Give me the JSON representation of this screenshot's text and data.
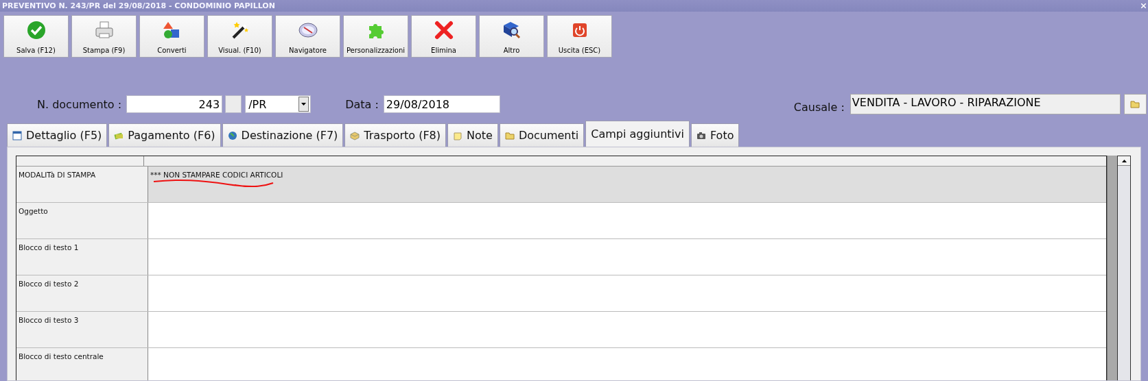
{
  "window": {
    "title": "PREVENTIVO N. 243/PR del 29/08/2018 - CONDOMINIO PAPILLON"
  },
  "toolbar": [
    {
      "label": "Salva (F12)",
      "kind": "check"
    },
    {
      "label": "Stampa (F9)",
      "kind": "printer"
    },
    {
      "label": "Converti",
      "kind": "convert"
    },
    {
      "label": "Visual. (F10)",
      "kind": "wand"
    },
    {
      "label": "Navigatore",
      "kind": "compass"
    },
    {
      "label": "Personalizzazioni",
      "kind": "puzzle"
    },
    {
      "label": "Elimina",
      "kind": "cross"
    },
    {
      "label": "Altro",
      "kind": "book"
    },
    {
      "label": "Uscita (ESC)",
      "kind": "power"
    }
  ],
  "form": {
    "document_label": "N. documento :",
    "document_number": "243",
    "series": "/PR",
    "date_label": "Data :",
    "date": "29/08/2018",
    "causale_label": "Causale :",
    "causale": "VENDITA - LAVORO - RIPARAZIONE"
  },
  "tabs": [
    {
      "label": "Dettaglio (F5)",
      "kind": "table",
      "selected": false
    },
    {
      "label": "Pagamento (F6)",
      "kind": "money",
      "selected": false
    },
    {
      "label": "Destinazione (F7)",
      "kind": "globe",
      "selected": false
    },
    {
      "label": "Trasporto (F8)",
      "kind": "box",
      "selected": false
    },
    {
      "label": "Note",
      "kind": "note",
      "selected": false
    },
    {
      "label": "Documenti",
      "kind": "folder",
      "selected": false
    },
    {
      "label": "Campi aggiuntivi",
      "kind": "none",
      "selected": true
    },
    {
      "label": "Foto",
      "kind": "camera",
      "selected": false
    }
  ],
  "grid": {
    "rows": [
      {
        "label": "MODALITà DI STAMPA",
        "value": "*** NON STAMPARE CODICI ARTICOLI",
        "selected": true
      },
      {
        "label": "Oggetto",
        "selected": false
      },
      {
        "label": "Blocco di testo 1",
        "selected": false
      },
      {
        "label": "Blocco di testo 2",
        "selected": false
      },
      {
        "label": "Blocco di testo 3",
        "selected": false
      },
      {
        "label": "Blocco di testo centrale",
        "selected": false
      }
    ]
  }
}
